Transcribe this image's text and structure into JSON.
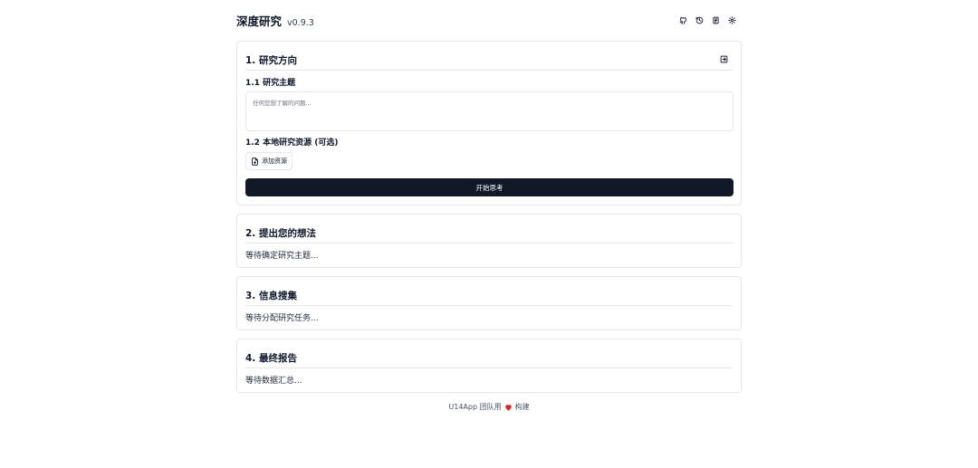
{
  "header": {
    "title": "深度研究",
    "version": "v0.9.3",
    "icons": [
      "github-icon",
      "history-icon",
      "notes-icon",
      "settings-icon"
    ]
  },
  "section1": {
    "title": "1. 研究方向",
    "topic_label": "1.1 研究主题",
    "topic_placeholder": "任何您想了解的问题...",
    "resources_label": "1.2 本地研究资源 (可选)",
    "add_resource_label": "添加资源",
    "start_button_label": "开始思考"
  },
  "section2": {
    "title": "2. 提出您的想法",
    "status": "等待确定研究主题..."
  },
  "section3": {
    "title": "3. 信息搜集",
    "status": "等待分配研究任务..."
  },
  "section4": {
    "title": "4. 最终报告",
    "status": "等待数据汇总..."
  },
  "footer": {
    "text_before": "U14App 团队用",
    "text_after": "构建",
    "heart_color": "#dc2626"
  },
  "colors": {
    "primary_button": "#111827",
    "border": "#e5e7eb"
  }
}
